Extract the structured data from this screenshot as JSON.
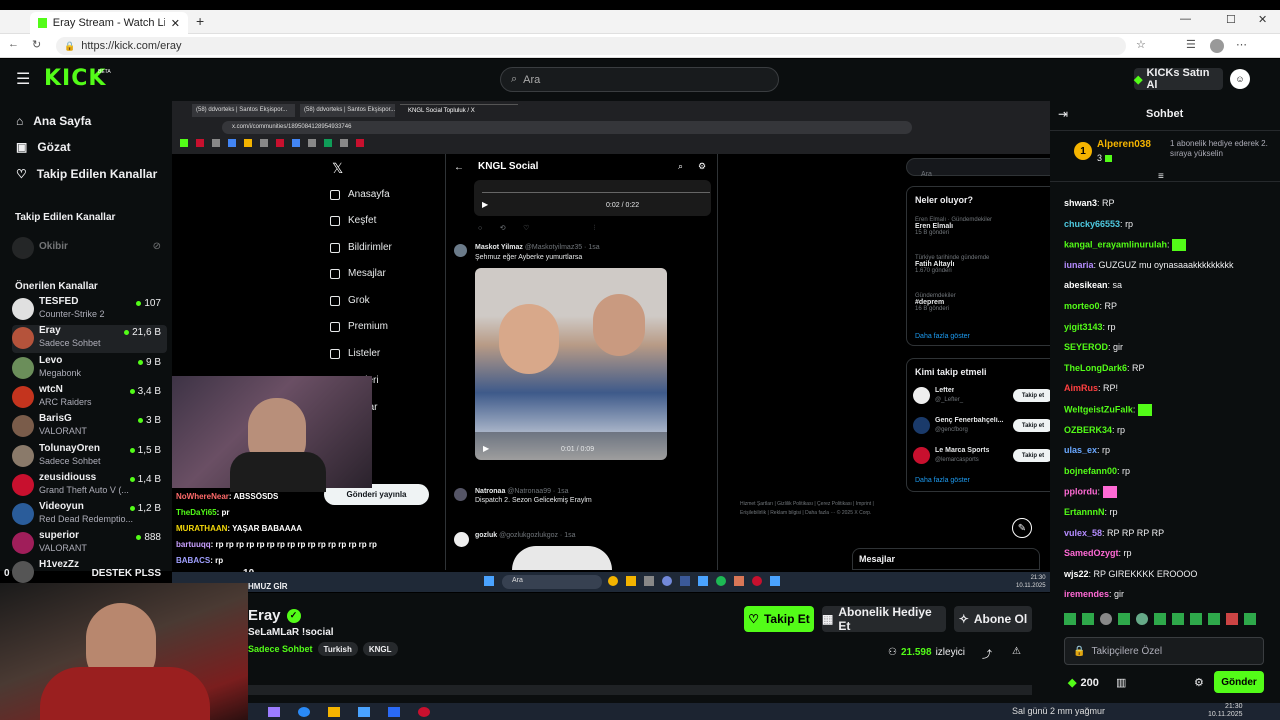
{
  "browser": {
    "tab_title": "Eray Stream - Watch Live on",
    "url": "https://kick.com/eray"
  },
  "kick": {
    "logo": "KICK",
    "logo_beta": "BETA",
    "search_placeholder": "Ara",
    "kicks_button": "KICKs Satın Al"
  },
  "sidebar": {
    "nav": [
      "Ana Sayfa",
      "Gözat",
      "Takip Edilen Kanallar"
    ],
    "followed_title": "Takip Edilen Kanallar",
    "followed": [
      {
        "name": "Okibir"
      }
    ],
    "recommended_title": "Önerilen Kanallar",
    "channels": [
      {
        "name": "TESFED",
        "category": "Counter-Strike 2",
        "viewers": "107",
        "color": "#e0e0e0"
      },
      {
        "name": "Eray",
        "category": "Sadece Sohbet",
        "viewers": "21,6 B",
        "color": "#b5533b"
      },
      {
        "name": "Levo",
        "category": "Megabonk",
        "viewers": "9 B",
        "color": "#6b8e5a"
      },
      {
        "name": "wtcN",
        "category": "ARC Raiders",
        "viewers": "3,4 B",
        "color": "#c4341e"
      },
      {
        "name": "BarisG",
        "category": "VALORANT",
        "viewers": "3 B",
        "color": "#7a5c4a"
      },
      {
        "name": "TolunayOren",
        "category": "Sadece Sohbet",
        "viewers": "1,5 B",
        "color": "#8a7a6a"
      },
      {
        "name": "zeusidiouss",
        "category": "Grand Theft Auto V (...",
        "viewers": "1,4 B",
        "color": "#c8102e"
      },
      {
        "name": "Videoyun",
        "category": "Red Dead Redemptio...",
        "viewers": "1,2 B",
        "color": "#2a5c9a"
      },
      {
        "name": "superior",
        "category": "VALORANT",
        "viewers": "888",
        "color": "#a01e5a"
      },
      {
        "name": "H1vezZz",
        "category": "",
        "viewers": "",
        "color": "#555"
      }
    ]
  },
  "stream_view": {
    "inner_tabs": [
      "(58) ddvorteks | Santos Ekşispor...",
      "(58) ddvorteks | Santos Ekşispor...",
      "KNGL Social Topluluk / X"
    ],
    "inner_url": "x.com/i/communities/1895084128954933746",
    "x_nav": [
      "Anasayfa",
      "Keşfet",
      "Bildirimler",
      "Mesajlar",
      "Grok",
      "Premium",
      "Listeler",
      "aretleri",
      "uluklar",
      "fazla"
    ],
    "post_button": "Gönderi yayınla",
    "community_title": "KNGL Social",
    "video1_time": "0:02 / 0:22",
    "tweet1_user": "Maskot Yilmaz",
    "tweet1_handle": "@Maskotyilmaz35 · 1sa",
    "tweet1_text": "Şehmuz eğer Ayberke yumurtlarsa",
    "video2_time": "0:01 / 0:09",
    "tweet2_user": "Natronaa",
    "tweet2_handle": "@Natronaa99 · 1sa",
    "tweet2_text": "Dispatch 2. Sezon Gelicekmiş Eraylm",
    "tweet3_user": "gozluk",
    "tweet3_handle": "@gozlukgozlukgoz · 1sa",
    "right_search": "Ara",
    "trends_title": "Neler oluyor?",
    "trends": [
      {
        "meta": "Eren Elmalı · Gündemdekiler",
        "name": "Eren Elmalı",
        "count": "15 B gönderi"
      },
      {
        "meta": "Türkiye tarihinde gündemde",
        "name": "Fatih Altaylı",
        "count": "1.670 gönderi"
      },
      {
        "meta": "Gündemdekiler",
        "name": "#deprem",
        "count": "16 B gönderi"
      }
    ],
    "show_more": "Daha fazla göster",
    "follow_title": "Kimi takip etmeli",
    "follow": [
      {
        "name": "Lefter",
        "handle": "@_Lefter_",
        "color": "#eee"
      },
      {
        "name": "Genç Fenerbahçeli...",
        "handle": "@gencfborg",
        "color": "#1a3a6a"
      },
      {
        "name": "Le Marca Sports",
        "handle": "@lemarcasports",
        "color": "#c8102e"
      }
    ],
    "follow_button": "Takip et",
    "show_more2": "Daha fazla göster",
    "footer_links": "Hizmet Şartları | Gizlilik Politikası | Çerez Politikası | Imprint | Erişilebilirlik | Reklam bilgisi | Daha fazla ··· © 2025 X Corp.",
    "messages_label": "Mesajlar",
    "taskbar_search": "Ara",
    "taskbar_time": "21:30",
    "taskbar_date": "10.11.2025",
    "webcam_chat": [
      {
        "user": "NoWhereNear",
        "text": ": ABSSÖSDS",
        "color": "#ff6a6a"
      },
      {
        "user": "TheDaYi65",
        "text": ": pr",
        "color": "#53fc18"
      },
      {
        "user": "MURATHAAN",
        "text": ": YAŞAR BABAAAA",
        "color": "#f5d90a"
      },
      {
        "user": "bartuuqq",
        "text": ": rp rp rp rp rp rp rp rp rp rp rp rp rp rp rp rp",
        "color": "#c9a0ff"
      },
      {
        "user": "BABACS",
        "text": ": rp",
        "color": "#a0a0ff"
      }
    ],
    "overlay_left": "0",
    "overlay_goal": "DESTEK PLSS",
    "overlay_count": "10",
    "overlay_sub": "HMUZ GİR"
  },
  "channel": {
    "name": "Eray",
    "title": "SeLaMLaR !social",
    "category": "Sadece Sohbet",
    "tags": [
      "Turkish",
      "KNGL"
    ],
    "follow_button": "Takip Et",
    "gift_button": "Abonelik Hediye Et",
    "subscribe_button": "Abone Ol",
    "viewers": "21.598",
    "viewers_label": "izleyici"
  },
  "chat": {
    "title": "Sohbet",
    "pinned_rank": "1",
    "pinned_user": "Alperen038",
    "pinned_count": "3",
    "pinned_text": "1 abonelik hediye ederek 2. sıraya yükselin",
    "messages": [
      {
        "user": "shwan3",
        "text": "RP",
        "color": "#ffffff"
      },
      {
        "user": "chucky66553",
        "text": "rp",
        "color": "#4ec9e0"
      },
      {
        "user": "kangal_erayamlinurulah",
        "text": "",
        "color": "#53fc18"
      },
      {
        "user": "iunaria",
        "text": "GUZGUZ mu oynasaaakkkkkkkkk",
        "color": "#b58cff"
      },
      {
        "user": "abesikean",
        "text": "sa",
        "color": "#ffffff"
      },
      {
        "user": "morteo0",
        "text": "RP",
        "color": "#53fc18"
      },
      {
        "user": "yigit3143",
        "text": "rp",
        "color": "#53fc18"
      },
      {
        "user": "SEYEROD",
        "text": "gir",
        "color": "#53fc18"
      },
      {
        "user": "TheLongDark6",
        "text": "RP",
        "color": "#53fc18"
      },
      {
        "user": "AimRus",
        "text": "RP!",
        "color": "#ff4040"
      },
      {
        "user": "WeltgeistZuFalk",
        "text": "",
        "color": "#53fc18"
      },
      {
        "user": "OZBERK34",
        "text": "rp",
        "color": "#53fc18"
      },
      {
        "user": "ulas_ex",
        "text": "rp",
        "color": "#6aa8ff"
      },
      {
        "user": "bojnefann00",
        "text": "rp",
        "color": "#53fc18"
      },
      {
        "user": "pplordu",
        "text": "",
        "color": "#ff6ad5"
      },
      {
        "user": "ErtannnN",
        "text": "rp",
        "color": "#53fc18"
      },
      {
        "user": "vulex_58",
        "text": "RP RP RP RP",
        "color": "#b58cff"
      },
      {
        "user": "SamedOzygt",
        "text": "rp",
        "color": "#ff6ad5"
      },
      {
        "user": "wjs22",
        "text": "RP GIREKKKK EROOOO",
        "color": "#ffffff"
      },
      {
        "user": "iremendes",
        "text": "gir",
        "color": "#ff6ad5"
      }
    ],
    "input_placeholder": "Takipçilere Özel",
    "kicks_balance": "200",
    "send_button": "Gönder"
  },
  "os": {
    "weather": "Sal günü 2 mm yağmur",
    "time": "21:30",
    "date": "10.11.2025"
  },
  "colors": {
    "accent": "#53fc18",
    "bg": "#0b0e0f"
  }
}
